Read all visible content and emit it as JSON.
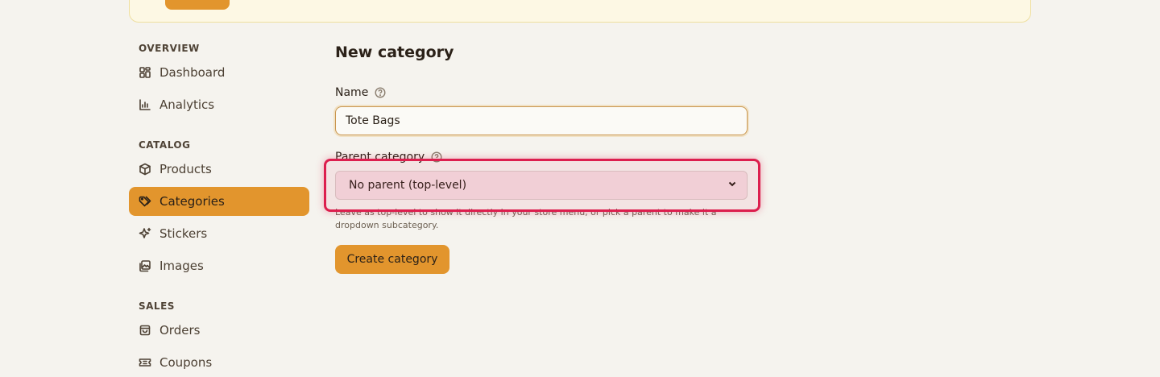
{
  "sidebar": {
    "sections": [
      {
        "label": "OVERVIEW",
        "items": [
          {
            "label": "Dashboard",
            "icon": "dashboard-icon"
          },
          {
            "label": "Analytics",
            "icon": "chart-icon"
          }
        ]
      },
      {
        "label": "CATALOG",
        "items": [
          {
            "label": "Products",
            "icon": "box-icon"
          },
          {
            "label": "Categories",
            "icon": "tag-icon",
            "active": true
          },
          {
            "label": "Stickers",
            "icon": "sparkle-icon"
          },
          {
            "label": "Images",
            "icon": "image-icon"
          }
        ]
      },
      {
        "label": "SALES",
        "items": [
          {
            "label": "Orders",
            "icon": "bag-icon"
          },
          {
            "label": "Coupons",
            "icon": "ticket-icon"
          }
        ]
      }
    ]
  },
  "main": {
    "title": "New category",
    "name_field": {
      "label": "Name",
      "value": "Tote Bags"
    },
    "parent_field": {
      "label": "Parent category",
      "selected": "No parent (top-level)",
      "help": "Leave as top-level to show it directly in your store menu, or pick a parent to make it a dropdown subcategory."
    },
    "submit_label": "Create category"
  },
  "colors": {
    "accent": "#e2952d",
    "background": "#f5f3ee",
    "highlight": "#dc1f4e"
  }
}
